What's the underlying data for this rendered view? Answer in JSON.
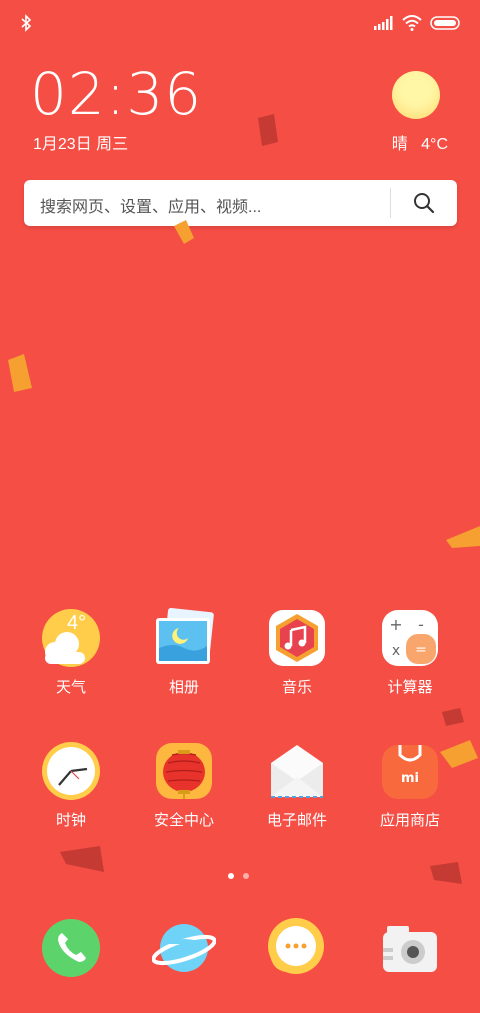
{
  "status_bar": {
    "bluetooth_icon": "bluetooth-icon",
    "signal_icon": "signal-icon",
    "wifi_icon": "wifi-icon",
    "battery_icon": "battery-icon"
  },
  "clock": {
    "time": "02:36",
    "date": "1月23日 周三"
  },
  "weather": {
    "condition": "晴",
    "temperature": "4°C",
    "icon": "sun-icon"
  },
  "search": {
    "placeholder": "搜索网页、设置、应用、视频...",
    "icon": "search-icon"
  },
  "apps": [
    {
      "label": "天气",
      "icon": "weather-app-icon",
      "badge": "4°"
    },
    {
      "label": "相册",
      "icon": "gallery-app-icon"
    },
    {
      "label": "音乐",
      "icon": "music-app-icon"
    },
    {
      "label": "计算器",
      "icon": "calculator-app-icon"
    },
    {
      "label": "时钟",
      "icon": "clock-app-icon"
    },
    {
      "label": "安全中心",
      "icon": "security-app-icon"
    },
    {
      "label": "电子邮件",
      "icon": "email-app-icon"
    },
    {
      "label": "应用商店",
      "icon": "app-store-icon",
      "badge": "mi"
    }
  ],
  "pager": {
    "pages": 2,
    "active": 1
  },
  "dock": [
    {
      "icon": "phone-icon"
    },
    {
      "icon": "browser-icon"
    },
    {
      "icon": "messages-icon"
    },
    {
      "icon": "camera-icon"
    }
  ],
  "colors": {
    "background": "#f54e45",
    "text": "#ffffff"
  }
}
